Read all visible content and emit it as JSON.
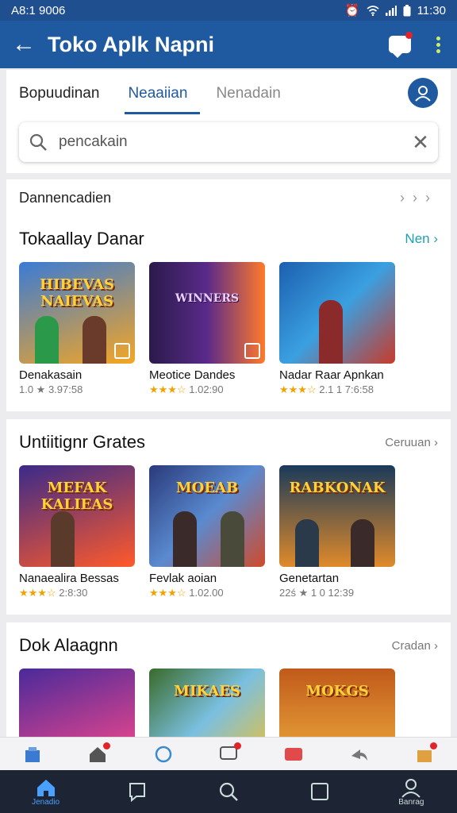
{
  "status": {
    "left": "A8:1 9006",
    "time": "11:30"
  },
  "appbar": {
    "title": "Toko Aplk Napni"
  },
  "tabs": [
    {
      "label": "Bopuudinan"
    },
    {
      "label": "Neaaiian"
    },
    {
      "label": "Nenadain"
    }
  ],
  "search": {
    "value": "pencakain"
  },
  "crumb": {
    "label": "Dannencadien"
  },
  "sections": [
    {
      "title": "Tokaallay Danar",
      "link": "Nen ›",
      "items": [
        {
          "name": "Denakasain",
          "rating": "1.0 ★ 3.97:58",
          "stars": "",
          "art": "HIBEVAS NAIEVAS",
          "c1": "#3a7bd5",
          "c2": "#f5a623"
        },
        {
          "name": "Meotice Dandes",
          "rating": "1.02:90",
          "stars": "★★★☆",
          "art": "WINNERS",
          "c1": "#2a1a4a",
          "c2": "#ff7a2a"
        },
        {
          "name": "Nadar Raar Apnkan",
          "rating": "2.1 1 7:6:58",
          "stars": "★★★☆",
          "art": "",
          "c1": "#1c5fb0",
          "c2": "#c83a2a"
        }
      ]
    },
    {
      "title": "Untiitignr Grates",
      "link": "Ceruuan ›",
      "items": [
        {
          "name": "Nanaealira Bessas",
          "rating": "2:8:30",
          "stars": "★★★☆",
          "art": "MEFAK KALIEAS",
          "c1": "#3a2a8a",
          "c2": "#ff5a2a"
        },
        {
          "name": "Fevlak aoian",
          "rating": "1.02.00",
          "stars": "★★★☆",
          "art": "MOEAB",
          "c1": "#2a3a7a",
          "c2": "#d04a2a"
        },
        {
          "name": "Genetartan",
          "rating": "22ś ★ 1 0 12:39",
          "stars": "",
          "art": "RABKONAK",
          "c1": "#1a3a5a",
          "c2": "#e08a2a"
        }
      ]
    },
    {
      "title": "Dok Alaagnn",
      "link": "Cradan ›",
      "items": [
        {
          "name": "",
          "rating": "",
          "stars": "",
          "art": "",
          "c1": "#4a2a9a",
          "c2": "#ff4a8a"
        },
        {
          "name": "",
          "rating": "",
          "stars": "",
          "art": "MIKAES",
          "c1": "#3a6a2a",
          "c2": "#f0c030"
        },
        {
          "name": "",
          "rating": "",
          "stars": "",
          "art": "MOKGS",
          "c1": "#c05a1a",
          "c2": "#f0b040"
        }
      ]
    }
  ],
  "bottom": [
    {
      "label": "Jenadio",
      "icon": "home-icon"
    },
    {
      "label": "",
      "icon": "bookmark-icon"
    },
    {
      "label": "",
      "icon": "search-icon"
    },
    {
      "label": "",
      "icon": "square-icon"
    },
    {
      "label": "Banrag",
      "icon": "profile-icon"
    }
  ],
  "colors": {
    "appbar": "#1f5aa0",
    "accent": "#1fa0b0",
    "stars": "#f4a200"
  }
}
